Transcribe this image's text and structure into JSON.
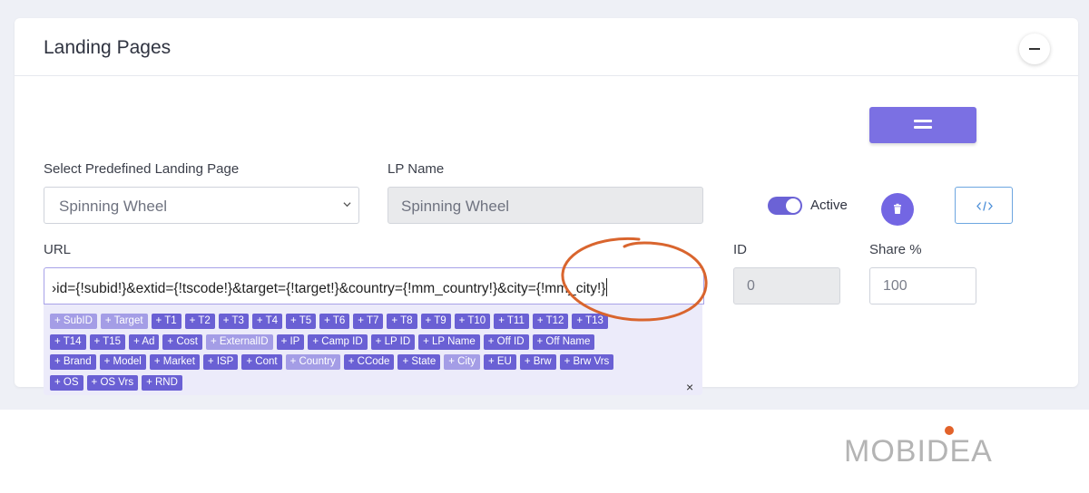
{
  "card": {
    "title": "Landing Pages"
  },
  "labels": {
    "select_predefined": "Select Predefined Landing Page",
    "lp_name": "LP Name",
    "url": "URL",
    "id": "ID",
    "share": "Share %"
  },
  "fields": {
    "predefined_value": "Spinning Wheel",
    "lp_name_value": "Spinning Wheel",
    "url_value": "›id={!subid!}&extid={!tscode!}&target={!target!}&country={!mm_country!}&city={!mm_city!}",
    "id_value": "0",
    "share_value": "100"
  },
  "toggle": {
    "label": "Active",
    "state": "on"
  },
  "tags": {
    "rows": [
      [
        {
          "label": "+ SubID",
          "used": true
        },
        {
          "label": "+ Target",
          "used": true
        },
        {
          "label": "+ T1",
          "used": false
        },
        {
          "label": "+ T2",
          "used": false
        },
        {
          "label": "+ T3",
          "used": false
        },
        {
          "label": "+ T4",
          "used": false
        },
        {
          "label": "+ T5",
          "used": false
        },
        {
          "label": "+ T6",
          "used": false
        },
        {
          "label": "+ T7",
          "used": false
        },
        {
          "label": "+ T8",
          "used": false
        },
        {
          "label": "+ T9",
          "used": false
        },
        {
          "label": "+ T10",
          "used": false
        },
        {
          "label": "+ T11",
          "used": false
        },
        {
          "label": "+ T12",
          "used": false
        },
        {
          "label": "+ T13",
          "used": false
        }
      ],
      [
        {
          "label": "+ T14",
          "used": false
        },
        {
          "label": "+ T15",
          "used": false
        },
        {
          "label": "+ Ad",
          "used": false
        },
        {
          "label": "+ Cost",
          "used": false
        },
        {
          "label": "+ ExternalID",
          "used": true
        },
        {
          "label": "+ IP",
          "used": false
        },
        {
          "label": "+ Camp ID",
          "used": false
        },
        {
          "label": "+ LP ID",
          "used": false
        },
        {
          "label": "+ LP Name",
          "used": false
        },
        {
          "label": "+ Off ID",
          "used": false
        },
        {
          "label": "+ Off Name",
          "used": false
        }
      ],
      [
        {
          "label": "+ Brand",
          "used": false
        },
        {
          "label": "+ Model",
          "used": false
        },
        {
          "label": "+ Market",
          "used": false
        },
        {
          "label": "+ ISP",
          "used": false
        },
        {
          "label": "+ Cont",
          "used": false
        },
        {
          "label": "+ Country",
          "used": true
        },
        {
          "label": "+ CCode",
          "used": false
        },
        {
          "label": "+ State",
          "used": false
        },
        {
          "label": "+ City",
          "used": true
        },
        {
          "label": "+ EU",
          "used": false
        },
        {
          "label": "+ Brw",
          "used": false
        },
        {
          "label": "+ Brw Vrs",
          "used": false
        }
      ],
      [
        {
          "label": "+ OS",
          "used": false
        },
        {
          "label": "+ OS Vrs",
          "used": false
        },
        {
          "label": "+ RND",
          "used": false
        }
      ]
    ],
    "close": "×"
  },
  "icons": {
    "collapse": "minus-icon",
    "menu": "equals-icon",
    "select": "chevron-down-icon",
    "delete": "trash-icon",
    "code": "code-icon"
  },
  "brand": {
    "logo_text": "MOBIDEA"
  },
  "colors": {
    "accent": "#7b70e3",
    "tag": "#6a60d4",
    "tag_used": "#a49de6",
    "annotation": "#d9652e"
  }
}
